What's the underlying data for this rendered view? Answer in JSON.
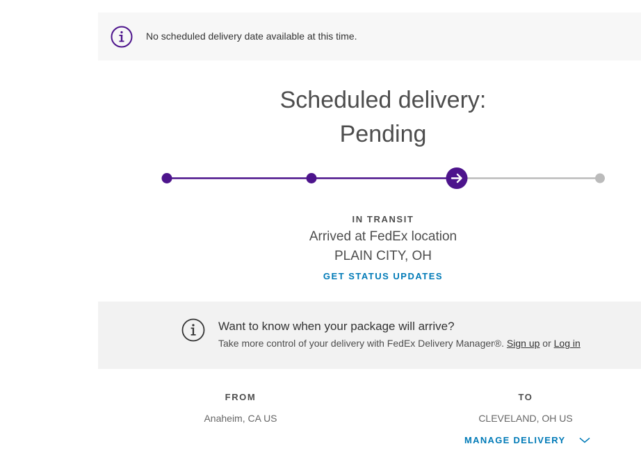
{
  "alert": {
    "text": "No scheduled delivery date available at this time.",
    "icon": "info-icon"
  },
  "headline": {
    "line1": "Scheduled delivery:",
    "line2": "Pending"
  },
  "tracker": {
    "steps_total": 4,
    "current_step": 3,
    "active_color": "#4d148c",
    "inactive_color": "#bbbbbb"
  },
  "status": {
    "label": "IN TRANSIT",
    "detail": "Arrived at FedEx location",
    "location": "PLAIN CITY, OH",
    "link": "GET STATUS UPDATES"
  },
  "promo": {
    "icon": "info-icon",
    "title": "Want to know when your package will arrive?",
    "text": "Take more control of your delivery with FedEx Delivery Manager®.",
    "signup": "Sign up",
    "or": "or",
    "login": "Log in"
  },
  "from": {
    "label": "FROM",
    "value": "Anaheim, CA US"
  },
  "to": {
    "label": "TO",
    "value": "CLEVELAND, OH US"
  },
  "manage": {
    "label": "MANAGE DELIVERY",
    "icon": "chevron-down-icon"
  },
  "colors": {
    "brand_purple": "#4d148c",
    "link_blue": "#007ab7"
  }
}
